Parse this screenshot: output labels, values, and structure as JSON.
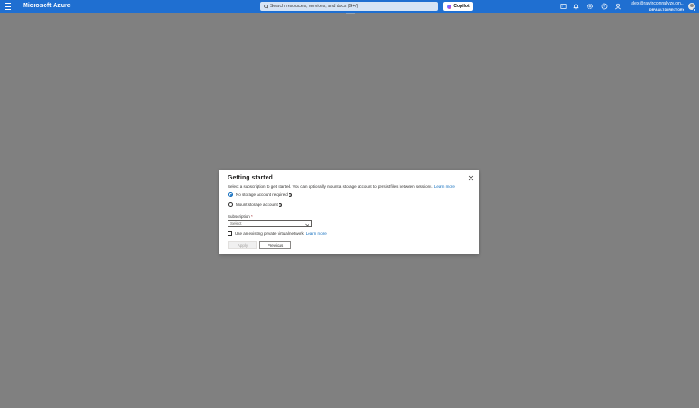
{
  "topbar": {
    "brand": "Microsoft Azure",
    "search_placeholder": "Search resources, services, and docs (G+/)",
    "copilot_label": "Copilot",
    "icons": [
      "cloud-shell-icon",
      "bell-icon",
      "gear-icon",
      "help-icon",
      "feedback-icon"
    ],
    "account_email": "alex@ravinconnalyze.on...",
    "account_directory": "DEFAULT DIRECTORY"
  },
  "dialog": {
    "title": "Getting started",
    "description": "Select a subscription to get started. You can optionally mount a storage account to persist files between sessions.",
    "description_link": "Learn more",
    "options": [
      {
        "label": "No storage account required",
        "checked": true
      },
      {
        "label": "Mount storage account",
        "checked": false
      }
    ],
    "subscription_label": "Subscription",
    "subscription_required": "*",
    "subscription_value": "Select",
    "vnet_checkbox_label": "Use an existing private virtual network",
    "vnet_link": "Learn more",
    "apply_label": "Apply",
    "previous_label": "Previous"
  },
  "colors": {
    "topbar": "#1f6fd1",
    "overlay": "#808080",
    "link": "#0f6cbd"
  }
}
